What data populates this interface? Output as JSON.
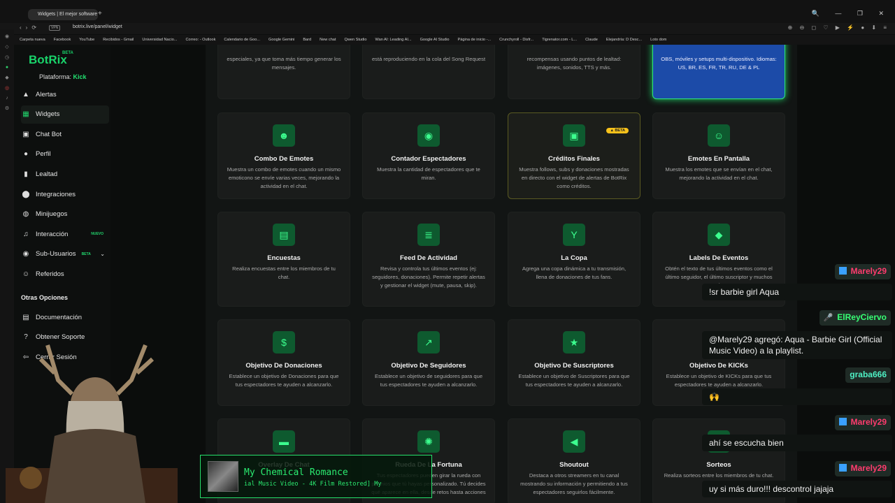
{
  "browser": {
    "tab_title": "Widgets | El mejor software",
    "url": "botrix.live/panel/widget",
    "vpn": "VPN",
    "bookmarks": [
      "Carpeta nueva",
      "Facebook",
      "YouTube",
      "Recibidos - Gmail",
      "Universidad Nacio...",
      "Correo: - Outlook",
      "Calendario de Goo...",
      "Google Gemini",
      "Bard",
      "New chat",
      "Qwen Studio",
      "Wan AI: Leading AI...",
      "Google AI Studio",
      "Página de inicio -...",
      "Crunchyroll - Disfr...",
      "Tigrenator.com - L...",
      "Claude",
      "Elejandría: D Desc...",
      "Loto dom"
    ]
  },
  "sidebar": {
    "logo": "BotRix",
    "logo_badge": "BETA",
    "platform_label": "Plataforma:",
    "platform_value": "Kick",
    "items": [
      {
        "label": "Alertas",
        "icon": "alert-icon"
      },
      {
        "label": "Widgets",
        "icon": "widgets-icon"
      },
      {
        "label": "Chat Bot",
        "icon": "chat-bot-icon"
      },
      {
        "label": "Perfil",
        "icon": "profile-icon"
      },
      {
        "label": "Lealtad",
        "icon": "loyalty-icon"
      },
      {
        "label": "Integraciones",
        "icon": "integrations-icon"
      },
      {
        "label": "Minijuegos",
        "icon": "gamepad-icon"
      },
      {
        "label": "Interacción",
        "icon": "music-icon",
        "badge": "NUEVO"
      },
      {
        "label": "Sub-Usuarios",
        "icon": "users-icon",
        "badge": "BETA"
      },
      {
        "label": "Referidos",
        "icon": "referrals-icon"
      }
    ],
    "other_heading": "Otras Opciones",
    "other_items": [
      {
        "label": "Documentación",
        "icon": "document-icon"
      },
      {
        "label": "Obtener Soporte",
        "icon": "help-icon"
      },
      {
        "label": "Cerrar Sesión",
        "icon": "logout-icon"
      }
    ]
  },
  "widgets": {
    "top_row": [
      "especiales, ya que toma más tiempo generar los mensajes.",
      "está reproduciendo en la cola del Song Request",
      "recompensas usando puntos de lealtad: imágenes, sonidos, TTS y más.",
      "OBS, móviles y setups multi-dispositivo. Idiomas: US, BR, ES, FR, TR, RU, DE & PL"
    ],
    "cards": [
      {
        "title": "Combo De Emotes",
        "desc": "Muestra un combo de emotes cuando un mismo emoticono se envíe varias veces, mejorando la actividad en el chat.",
        "icon": "smile-icon"
      },
      {
        "title": "Contador Espectadores",
        "desc": "Muestra la cantidad de espectadores que te miran.",
        "icon": "eye-icon"
      },
      {
        "title": "Créditos Finales",
        "desc": "Muestra follows, subs y donaciones mostradas en directo con el widget de alertas de BotRix como créditos.",
        "icon": "film-icon",
        "badge": "BETA"
      },
      {
        "title": "Emotes En Pantalla",
        "desc": "Muestra los emotes que se envían en el chat, mejorando la actividad en el chat.",
        "icon": "emoji-icon"
      },
      {
        "title": "Encuestas",
        "desc": "Realiza encuestas entre los miembros de tu chat.",
        "icon": "poll-icon"
      },
      {
        "title": "Feed De Actividad",
        "desc": "Revisa y controla tus últimos eventos (ej: seguidores, donaciones). Permite repetir alertas y gestionar el widget (mute, pausa, skip).",
        "icon": "list-icon"
      },
      {
        "title": "La Copa",
        "desc": "Agrega una copa dinámica a tu transmisión, llena de donaciones de tus fans.",
        "icon": "cup-icon"
      },
      {
        "title": "Labels De Eventos",
        "desc": "Obtén el texto de tus últimos eventos como el último seguidor, el último suscriptor y muchos más.",
        "icon": "tag-icon"
      },
      {
        "title": "Objetivo De Donaciones",
        "desc": "Establece un objetivo de Donaciones para que tus espectadores te ayuden a alcanzarlo.",
        "icon": "dollar-icon"
      },
      {
        "title": "Objetivo De Seguidores",
        "desc": "Establece un objetivo de seguidores para que tus espectadores te ayuden a alcanzarlo.",
        "icon": "chart-icon"
      },
      {
        "title": "Objetivo De Suscriptores",
        "desc": "Establece un objetivo de Suscriptores para que tus espectadores te ayuden a alcanzarlo.",
        "icon": "star-icon"
      },
      {
        "title": "Objetivo De KICKs",
        "desc": "Establece un objetivo de KICKs para que tus espectadores te ayuden a alcanzarlo.",
        "icon": "kick-icon"
      },
      {
        "title": "Overlay De Chat",
        "desc": "",
        "icon": "chat-icon"
      },
      {
        "title": "Rueda De La Fortuna",
        "desc": "Tus espectadores pueden girar la rueda con premios que tú hayas personalizado. Tú decides qué aparece en ella, desde retos hasta acciones",
        "icon": "wheel-icon"
      },
      {
        "title": "Shoutout",
        "desc": "Destaca a otros streamers en tu canal mostrando su información y permitiendo a tus espectadores seguirlos fácilmente.",
        "icon": "megaphone-icon"
      },
      {
        "title": "Sorteos",
        "desc": "Realiza sorteos entre los miembros de tu chat.",
        "icon": "gift-icon"
      }
    ]
  },
  "music": {
    "title": "My Chemical Romance",
    "subtitle": "ial Music Video - 4K Film Restored]   My"
  },
  "chat": [
    {
      "user": "Marely29",
      "color": "#ff3c6e",
      "message": "!sr barbie girl Aqua"
    },
    {
      "user": "ElReyCiervo",
      "color": "#37ff74",
      "message": ""
    },
    {
      "user": "",
      "color": "",
      "message": "@Marely29 agregó: Aqua - Barbie Girl (Official Music Video) a la playlist."
    },
    {
      "user": "graba666",
      "color": "#4ef0c4",
      "message": "🙌"
    },
    {
      "user": "Marely29",
      "color": "#ff3c6e",
      "message": "ahí se escucha bien"
    },
    {
      "user": "Marely29",
      "color": "#ff3c6e",
      "message": "uy si más duro!!! descontrol jajaja"
    }
  ],
  "colors": {
    "accent": "#21d66d",
    "card_bg": "#1a1c1b",
    "highlight_card": "#1c4ba8"
  }
}
